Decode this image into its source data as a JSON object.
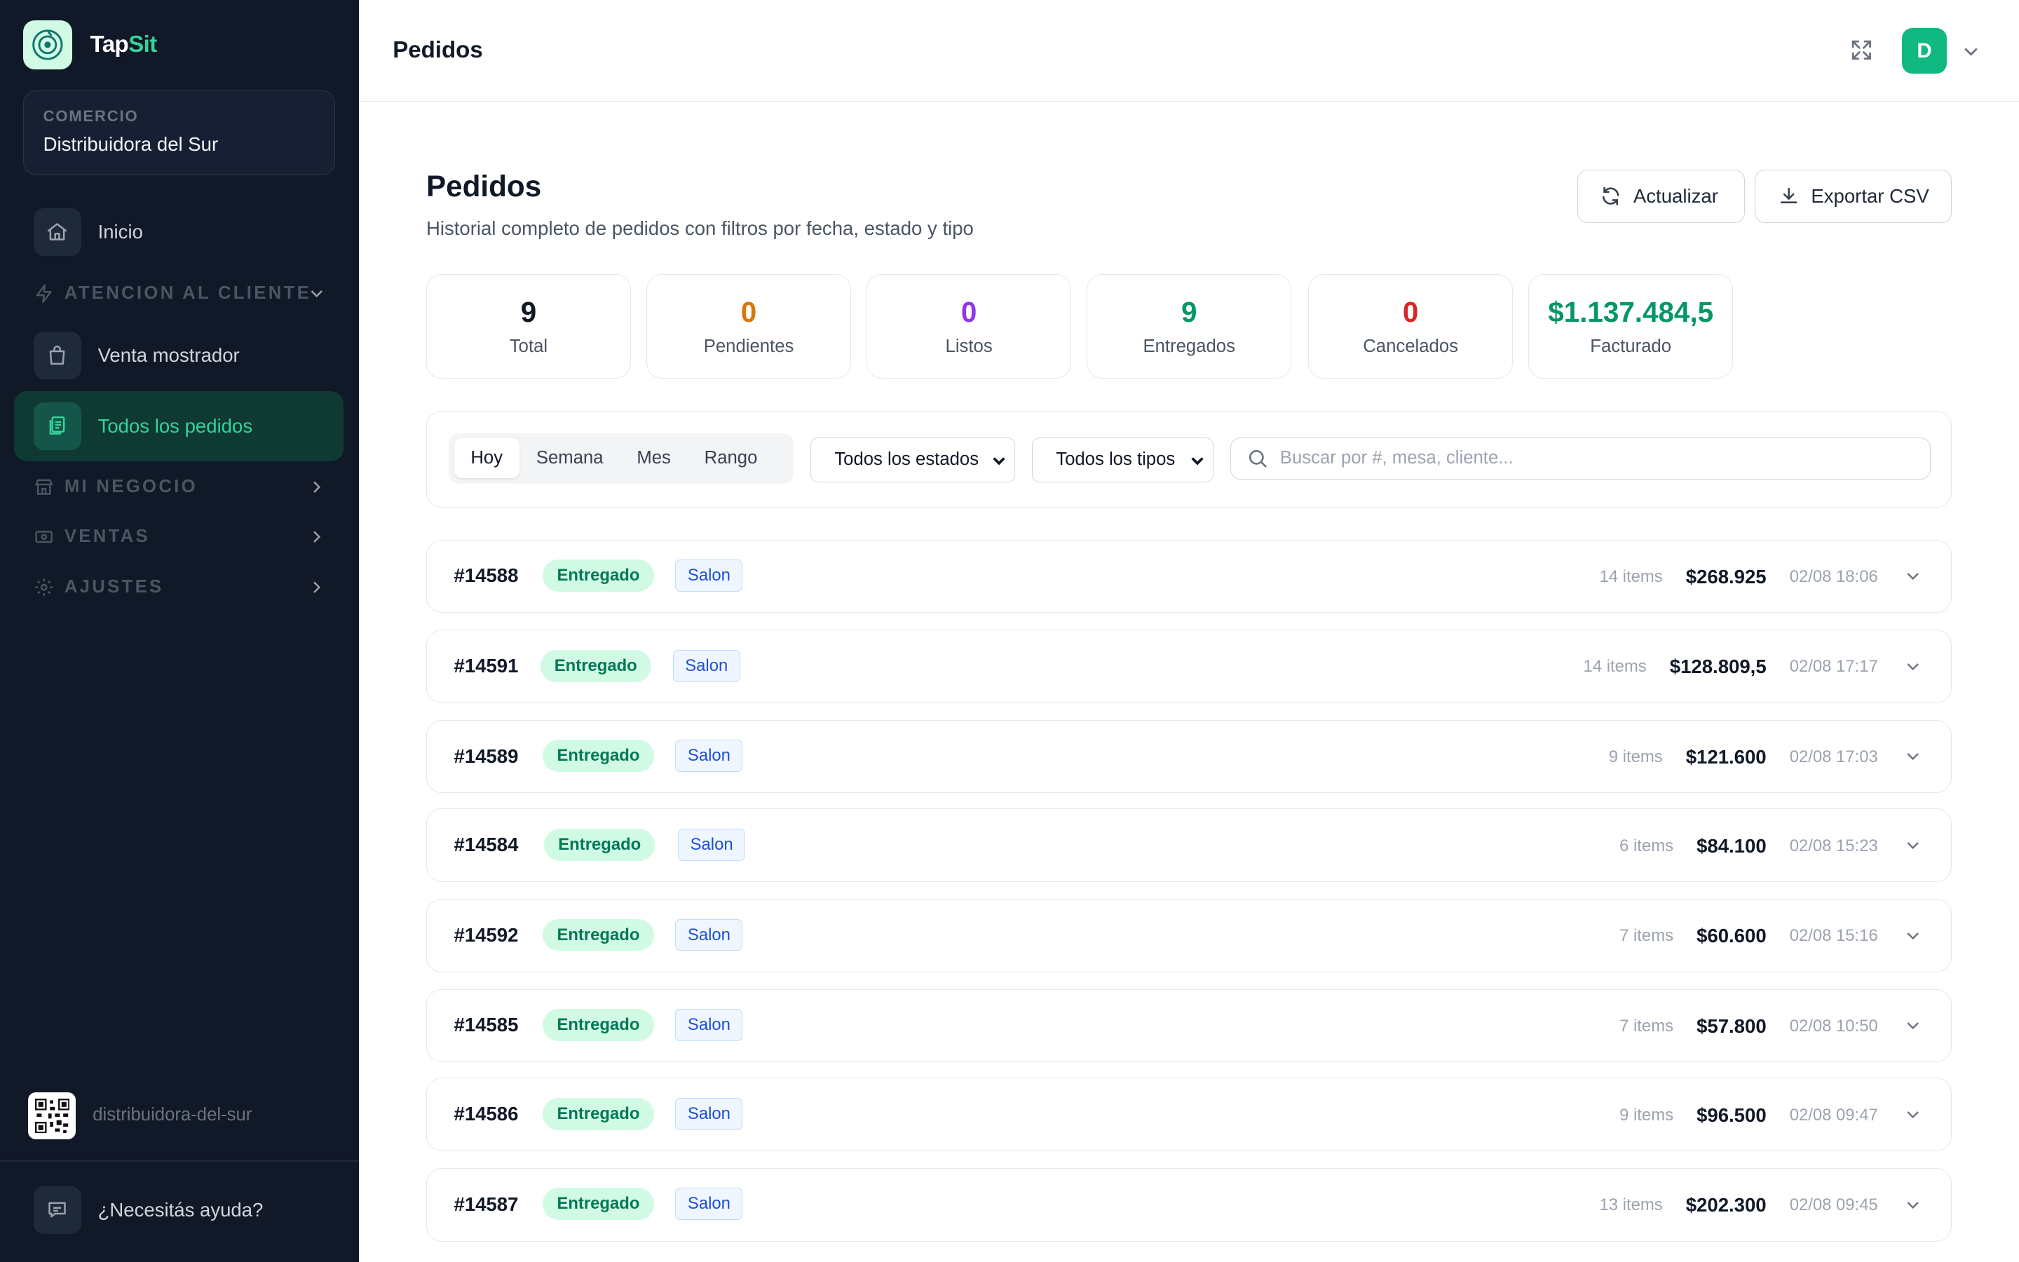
{
  "brand": {
    "name_part1": "Tap",
    "name_part2": "Sit"
  },
  "shop": {
    "label": "COMERCIO",
    "name": "Distribuidora del Sur"
  },
  "sidebar": {
    "items": [
      {
        "label": "Inicio",
        "icon": "home-icon"
      },
      {
        "section": "ATENCION AL CLIENTE",
        "icon": "bolt-icon",
        "expanded": true
      },
      {
        "label": "Venta mostrador",
        "icon": "shopping-bag-icon"
      },
      {
        "label": "Todos los pedidos",
        "icon": "orders-icon",
        "active": true
      },
      {
        "section": "MI NEGOCIO",
        "icon": "store-icon"
      },
      {
        "section": "VENTAS",
        "icon": "cash-icon"
      },
      {
        "section": "AJUSTES",
        "icon": "gear-icon"
      }
    ],
    "slug": "distribuidora-del-sur",
    "help": "¿Necesitás ayuda?"
  },
  "topbar": {
    "title": "Pedidos",
    "avatar": "D"
  },
  "page": {
    "title": "Pedidos",
    "subtitle": "Historial completo de pedidos con filtros por fecha, estado y tipo",
    "refresh_label": "Actualizar",
    "export_label": "Exportar CSV"
  },
  "stats": [
    {
      "value": "9",
      "label": "Total",
      "color": "#111827"
    },
    {
      "value": "0",
      "label": "Pendientes",
      "color": "#d97706"
    },
    {
      "value": "0",
      "label": "Listos",
      "color": "#9333ea"
    },
    {
      "value": "9",
      "label": "Entregados",
      "color": "#059669"
    },
    {
      "value": "0",
      "label": "Cancelados",
      "color": "#dc2626"
    },
    {
      "value": "$1.137.484,5",
      "label": "Facturado",
      "color": "#059669"
    }
  ],
  "filters": {
    "periods": [
      "Hoy",
      "Semana",
      "Mes",
      "Rango"
    ],
    "active_period": "Hoy",
    "status_select": "Todos los estados",
    "type_select": "Todos los tipos",
    "search_placeholder": "Buscar por #, mesa, cliente..."
  },
  "orders": [
    {
      "id": "#14588",
      "status": "Entregado",
      "type": "Salon",
      "items": "14 items",
      "amount": "$268.925",
      "date": "02/08 18:06"
    },
    {
      "id": "#14591",
      "status": "Entregado",
      "type": "Salon",
      "items": "14 items",
      "amount": "$128.809,5",
      "date": "02/08 17:17"
    },
    {
      "id": "#14589",
      "status": "Entregado",
      "type": "Salon",
      "items": "9 items",
      "amount": "$121.600",
      "date": "02/08 17:03"
    },
    {
      "id": "#14584",
      "status": "Entregado",
      "type": "Salon",
      "items": "6 items",
      "amount": "$84.100",
      "date": "02/08 15:23"
    },
    {
      "id": "#14592",
      "status": "Entregado",
      "type": "Salon",
      "items": "7 items",
      "amount": "$60.600",
      "date": "02/08 15:16"
    },
    {
      "id": "#14585",
      "status": "Entregado",
      "type": "Salon",
      "items": "7 items",
      "amount": "$57.800",
      "date": "02/08 10:50"
    },
    {
      "id": "#14586",
      "status": "Entregado",
      "type": "Salon",
      "items": "9 items",
      "amount": "$96.500",
      "date": "02/08 09:47"
    },
    {
      "id": "#14587",
      "status": "Entregado",
      "type": "Salon",
      "items": "13 items",
      "amount": "$202.300",
      "date": "02/08 09:45"
    }
  ]
}
